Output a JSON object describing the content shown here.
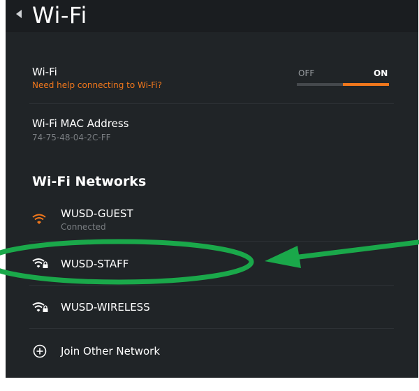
{
  "header": {
    "title": "Wi-Fi"
  },
  "wifi_toggle": {
    "label": "Wi-Fi",
    "help_link": "Need help connecting to Wi-Fi?",
    "off_label": "OFF",
    "on_label": "ON",
    "state": "on"
  },
  "mac": {
    "label": "Wi-Fi MAC Address",
    "value": "74-75-48-04-2C-FF"
  },
  "networks": {
    "section_title": "Wi-Fi Networks",
    "items": [
      {
        "name": "WUSD-GUEST",
        "status": "Connected",
        "icon": "wifi-open-icon",
        "color": "#f0771c"
      },
      {
        "name": "WUSD-STAFF",
        "icon": "wifi-locked-icon",
        "color": "#ffffff"
      },
      {
        "name": "WUSD-WIRELESS",
        "icon": "wifi-locked-icon",
        "color": "#ffffff"
      }
    ],
    "join_other": "Join Other Network"
  },
  "colors": {
    "background": "#202427",
    "accent": "#f0771c",
    "annotation": "#1aa84a"
  }
}
